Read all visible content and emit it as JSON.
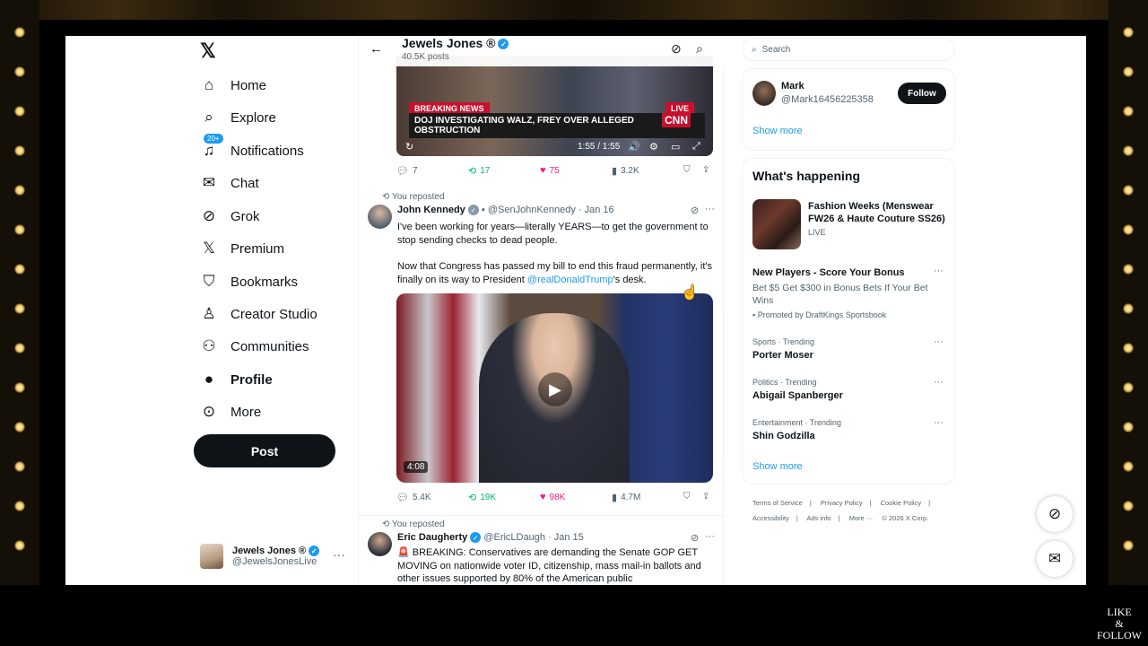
{
  "overlay": {
    "like_follow_1": "LIKE",
    "like_follow_2": "&",
    "like_follow_3": "FOLLOW"
  },
  "nav": {
    "logo": "𝕏",
    "items": [
      {
        "label": "Home",
        "icon": "home-icon",
        "glyph": "⌂"
      },
      {
        "label": "Explore",
        "icon": "search-icon",
        "glyph": "⌕"
      },
      {
        "label": "Notifications",
        "icon": "bell-icon",
        "glyph": "🔔",
        "badge": "20+"
      },
      {
        "label": "Chat",
        "icon": "mail-icon",
        "glyph": "✉"
      },
      {
        "label": "Grok",
        "icon": "grok-icon",
        "glyph": "⊘"
      },
      {
        "label": "Premium",
        "icon": "x-premium-icon",
        "glyph": "𝕏"
      },
      {
        "label": "Bookmarks",
        "icon": "bookmark-icon",
        "glyph": "🔖"
      },
      {
        "label": "Creator Studio",
        "icon": "creator-studio-icon",
        "glyph": "♙"
      },
      {
        "label": "Communities",
        "icon": "communities-icon",
        "glyph": "👥"
      },
      {
        "label": "Profile",
        "icon": "profile-icon",
        "glyph": "👤"
      },
      {
        "label": "More",
        "icon": "more-circle-icon",
        "glyph": "⋯"
      }
    ],
    "post_label": "Post"
  },
  "account": {
    "name": "Jewels Jones ®",
    "handle": "@JewelsJonesLive",
    "more": "···"
  },
  "header": {
    "name": "Jewels Jones ®",
    "posts": "40.5K posts"
  },
  "video1": {
    "breaking": "BREAKING NEWS",
    "live": "LIVE",
    "headline": "DOJ INVESTIGATING WALZ, FREY OVER ALLEGED OBSTRUCTION",
    "network": "CNN",
    "time": "1:55 / 1:55"
  },
  "tweet1_actions": {
    "replies": "7",
    "reposts": "17",
    "likes": "75",
    "views": "3.2K"
  },
  "tweet2": {
    "reposted": "You reposted",
    "name": "John Kennedy",
    "handle": "@SenJohnKennedy",
    "date": "· Jan 16",
    "text1": "I've been working for years—literally YEARS—to get the government to stop sending checks to dead people.",
    "text2_a": "Now that Congress has passed my bill to end this fraud permanently, it's finally on its way to President ",
    "text2_link": "@realDonaldTrump",
    "text2_b": "'s desk.",
    "duration": "4:08",
    "replies": "5.4K",
    "reposts": "19K",
    "likes": "98K",
    "views": "4.7M"
  },
  "tweet3": {
    "reposted": "You reposted",
    "name": "Eric Daugherty",
    "handle": "@EricLDaugh",
    "date": "· Jan 15",
    "text": "🚨 BREAKING: Conservatives are demanding the Senate GOP GET MOVING on nationwide voter ID, citizenship, mass mail-in ballots and other issues supported by 80% of the American public"
  },
  "right": {
    "search_placeholder": "Search",
    "who": {
      "name": "Mark",
      "handle": "@Mark16456225358",
      "follow": "Follow"
    },
    "show_more": "Show more",
    "whats_happening": "What's happening",
    "fashion": {
      "title": "Fashion Weeks (Menswear FW26 & Haute Couture SS26)",
      "status": "LIVE"
    },
    "promo": {
      "title": "New Players - Score Your Bonus",
      "body": "Bet $5 Get $300 in Bonus Bets If Your Bet Wins",
      "by": "Promoted by DraftKings Sportsbook"
    },
    "trends": [
      {
        "context": "Sports · Trending",
        "name": "Porter Moser"
      },
      {
        "context": "Politics · Trending",
        "name": "Abigail Spanberger"
      },
      {
        "context": "Entertainment · Trending",
        "name": "Shin Godzilla"
      }
    ],
    "show_more_2": "Show more",
    "footer1": [
      "Terms of Service",
      "|",
      "Privacy Policy",
      "|",
      "Cookie Policy",
      "|"
    ],
    "footer2": [
      "Accessibility",
      "|",
      "Ads info",
      "|",
      "More ···",
      "© 2026 X Corp."
    ]
  }
}
